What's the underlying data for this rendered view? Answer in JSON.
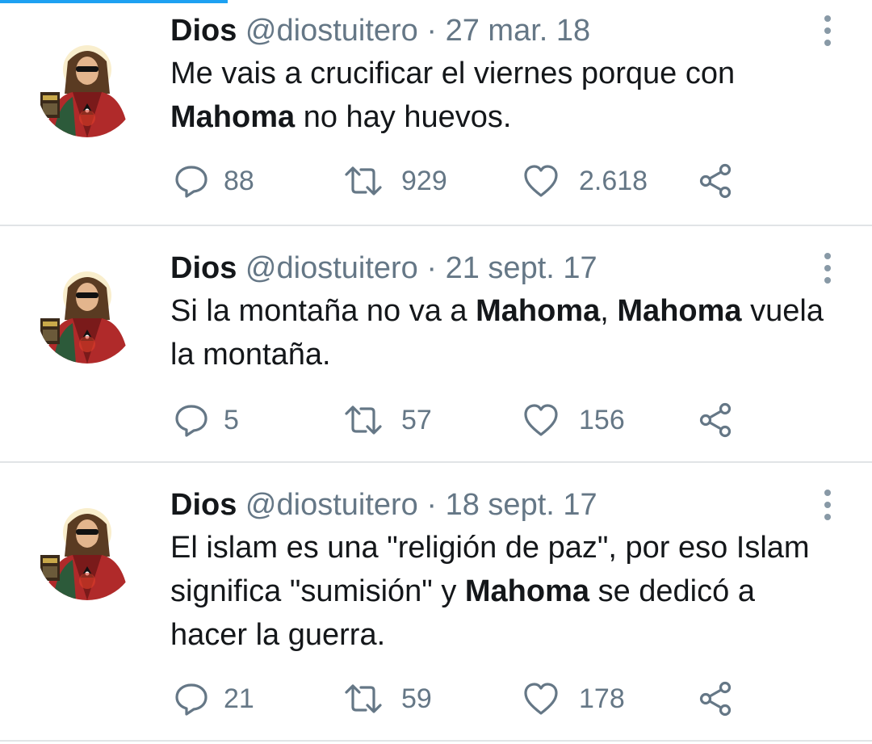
{
  "colors": {
    "accent": "#1da1f2",
    "secondary_text": "#657786",
    "divider": "#e1e4e6"
  },
  "icons": {
    "reply": "reply-icon",
    "retweet": "retweet-icon",
    "like": "heart-icon",
    "share": "share-icon",
    "more": "more-options-icon"
  },
  "tweets": [
    {
      "name": "Dios",
      "handle": "@diostuitero",
      "separator": "·",
      "date": "27 mar. 18",
      "text": [
        {
          "t": "Me vais a crucificar el viernes porque con ",
          "bold": false
        },
        {
          "t": "Mahoma",
          "bold": true
        },
        {
          "t": " no hay huevos.",
          "bold": false
        }
      ],
      "replies": "88",
      "retweets": "929",
      "likes": "2.618"
    },
    {
      "name": "Dios",
      "handle": "@diostuitero",
      "separator": "·",
      "date": "21 sept. 17",
      "text": [
        {
          "t": "Si la montaña no va a ",
          "bold": false
        },
        {
          "t": "Mahoma",
          "bold": true
        },
        {
          "t": ", ",
          "bold": false
        },
        {
          "t": "Mahoma",
          "bold": true
        },
        {
          "t": " vuela la montaña.",
          "bold": false
        }
      ],
      "replies": "5",
      "retweets": "57",
      "likes": "156"
    },
    {
      "name": "Dios",
      "handle": "@diostuitero",
      "separator": "·",
      "date": "18 sept. 17",
      "text": [
        {
          "t": "El islam es una \"religión de paz\", por eso Islam significa \"sumisión\" y ",
          "bold": false
        },
        {
          "t": "Mahoma",
          "bold": true
        },
        {
          "t": " se dedicó a hacer la guerra.",
          "bold": false
        }
      ],
      "replies": "21",
      "retweets": "59",
      "likes": "178"
    }
  ]
}
